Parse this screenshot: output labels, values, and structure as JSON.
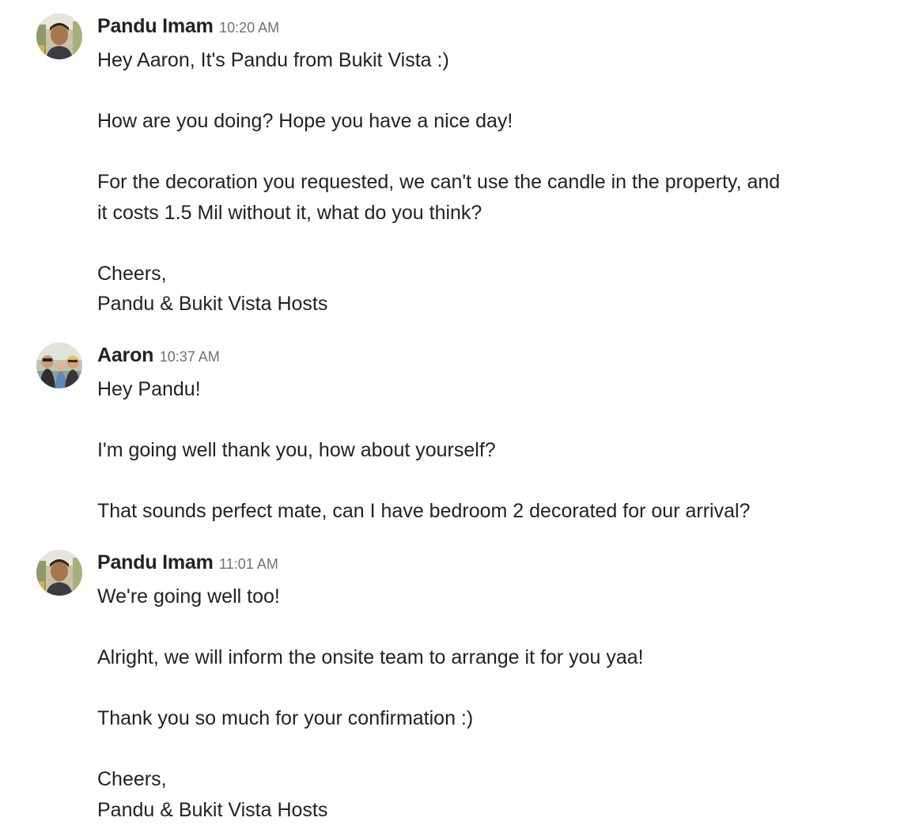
{
  "messages": [
    {
      "sender": "Pandu Imam",
      "time": "10:20 AM",
      "lines": [
        "Hey Aaron, It's Pandu from Bukit Vista :)",
        "",
        "How are you doing? Hope you have a nice day!",
        "",
        "For the decoration you requested, we can't use the candle in the property, and",
        "it costs 1.5 Mil without it, what do you think?",
        "",
        "Cheers,",
        "Pandu & Bukit Vista Hosts"
      ]
    },
    {
      "sender": "Aaron",
      "time": "10:37 AM",
      "lines": [
        "Hey Pandu!",
        "",
        "I'm going well thank you, how about yourself?",
        "",
        "That sounds perfect mate, can I have bedroom 2 decorated for our arrival?"
      ]
    },
    {
      "sender": "Pandu Imam",
      "time": "11:01 AM",
      "lines": [
        "We're going well too!",
        "",
        "Alright, we will inform the onsite team to arrange it for you yaa!",
        "",
        "Thank you so much for your confirmation :)",
        "",
        "Cheers,",
        "Pandu & Bukit Vista Hosts"
      ]
    }
  ],
  "colors": {
    "text": "#222222",
    "timestamp": "#717171",
    "background": "#ffffff"
  }
}
